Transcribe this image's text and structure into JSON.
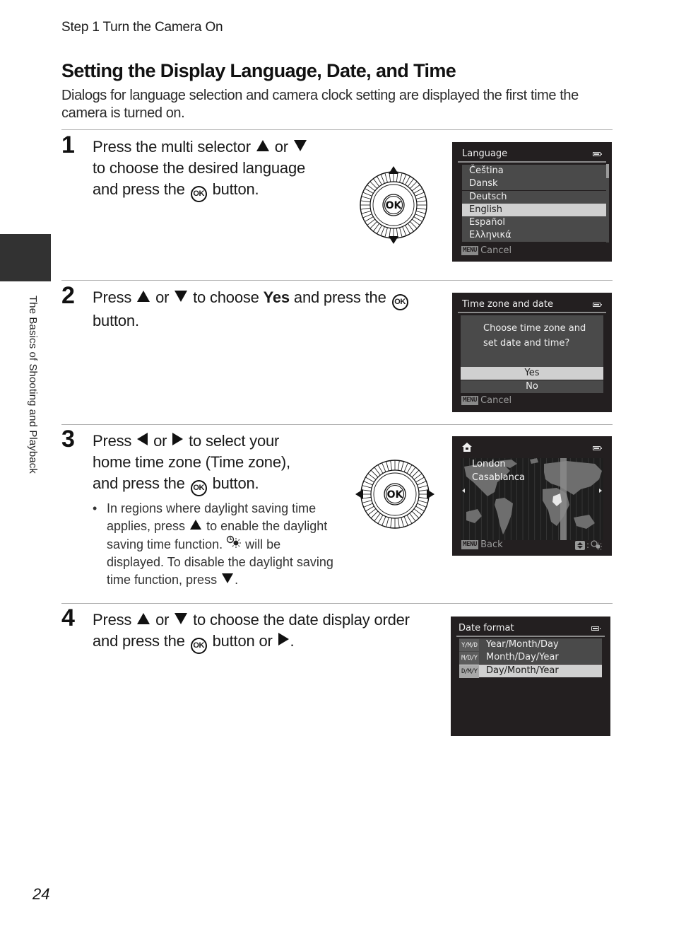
{
  "header": {
    "running_head": "Step 1 Turn the Camera On",
    "section_title": "Setting the Display Language, Date, and Time",
    "intro": "Dialogs for language selection and camera clock setting are displayed the first time the camera is turned on."
  },
  "side_tab": {
    "label": "The Basics of Shooting and Playback",
    "color": "#323232"
  },
  "icons": {
    "up": "up-triangle-icon",
    "down": "down-triangle-icon",
    "left": "left-triangle-icon",
    "right": "right-triangle-icon",
    "ok": "ok-button-icon",
    "dst": "daylight-saving-icon",
    "ok_text": "OK"
  },
  "steps": [
    {
      "number": "1",
      "lines": [
        "Press the multi selector",
        "or",
        "to choose the desired language",
        "and press the",
        "button."
      ],
      "dial": "up-down"
    },
    {
      "number": "2",
      "lines": [
        "Press",
        "or",
        "to choose",
        "Yes",
        "and press the",
        "button."
      ],
      "dial": "none"
    },
    {
      "number": "3",
      "lines": [
        "Press",
        "or",
        "to select your",
        "home time zone (Time zone),",
        "and press the",
        "button."
      ],
      "bullet": {
        "marker": "•",
        "parts": [
          "In regions where daylight saving time applies, press",
          "to enable the daylight saving time function.",
          "will be displayed. To disable the daylight saving time function, press",
          "."
        ]
      },
      "dial": "left-right"
    },
    {
      "number": "4",
      "lines": [
        "Press",
        "or",
        "to choose the date display order",
        "and press the",
        "button or",
        "."
      ],
      "dial": "none"
    }
  ],
  "screens": {
    "language": {
      "title": "Language",
      "items": [
        "Čeština",
        "Dansk",
        "Deutsch",
        "English",
        "Español",
        "Ελληνικά"
      ],
      "selected": "English",
      "footer_badge": "MENU",
      "footer_label": "Cancel"
    },
    "timezone_date": {
      "title": "Time zone and date",
      "message_line1": "Choose time zone and",
      "message_line2": "set date and time?",
      "options": [
        "Yes",
        "No"
      ],
      "selected": "Yes",
      "footer_badge": "MENU",
      "footer_label": "Cancel"
    },
    "time_zone_map": {
      "cities": [
        "London",
        "Casablanca"
      ],
      "footer_badge": "MENU",
      "footer_label": "Back"
    },
    "date_format": {
      "title": "Date format",
      "items": [
        {
          "code": "Y/M/D",
          "label": "Year/Month/Day"
        },
        {
          "code": "M/D/Y",
          "label": "Month/Day/Year"
        },
        {
          "code": "D/M/Y",
          "label": "Day/Month/Year"
        }
      ],
      "selected": "Day/Month/Year"
    }
  },
  "colors": {
    "screen_bg": "#231f20",
    "row_bg": "#4a4a4a",
    "row_selected": "#d0d0d0"
  },
  "page_number": "24"
}
